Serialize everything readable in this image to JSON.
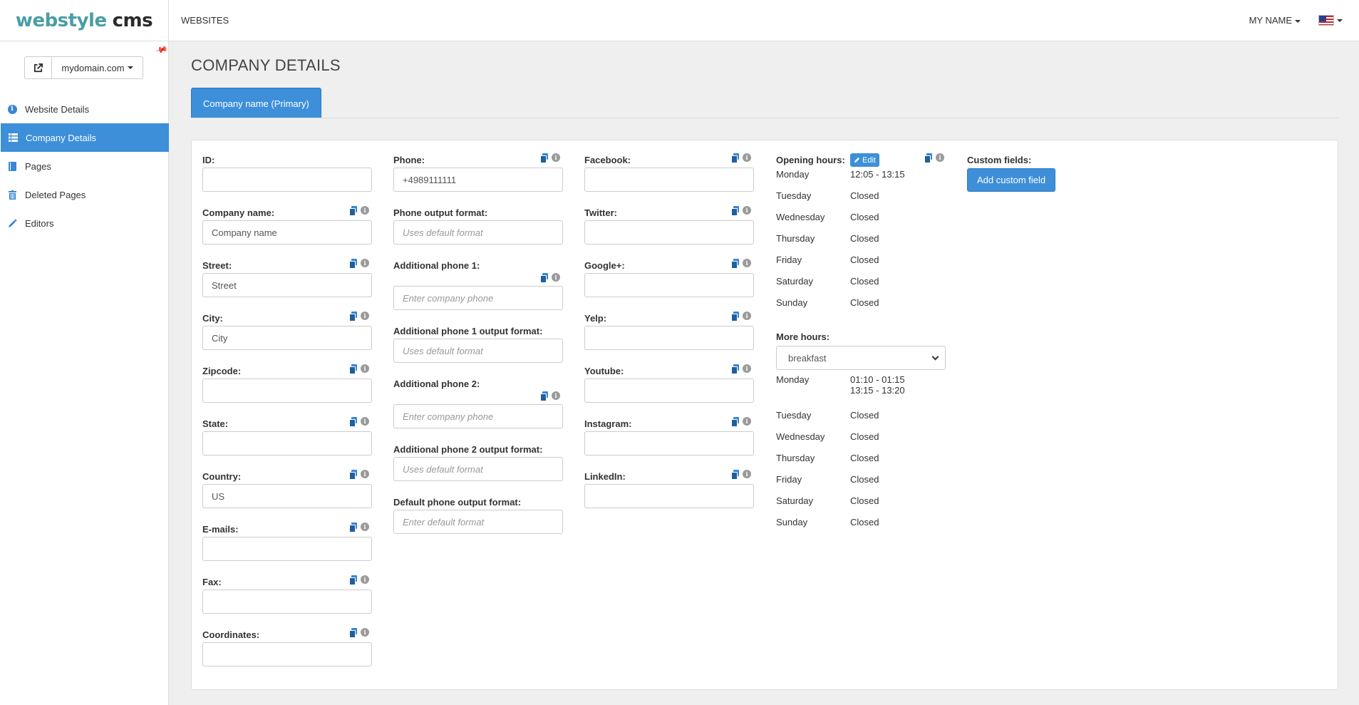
{
  "header": {
    "logo_part1": "webstyle",
    "logo_part2": "cms",
    "nav_websites": "WEBSITES",
    "user_menu": "MY NAME"
  },
  "sidebar": {
    "domain": "mydomain.com",
    "items": [
      {
        "label": "Website Details",
        "icon": "info-icon"
      },
      {
        "label": "Company Details",
        "icon": "list-icon",
        "active": true
      },
      {
        "label": "Pages",
        "icon": "book-icon"
      },
      {
        "label": "Deleted Pages",
        "icon": "trash-icon"
      },
      {
        "label": "Editors",
        "icon": "pencil-icon"
      }
    ]
  },
  "main": {
    "title": "COMPANY DETAILS",
    "tab_primary": "Company name (Primary)"
  },
  "col1": [
    {
      "label": "ID:",
      "value": "",
      "placeholder": ""
    },
    {
      "label": "Company name:",
      "value": "",
      "placeholder": "Company name"
    },
    {
      "label": "Street:",
      "value": "",
      "placeholder": "Street"
    },
    {
      "label": "City:",
      "value": "",
      "placeholder": "City"
    },
    {
      "label": "Zipcode:",
      "value": "",
      "placeholder": ""
    },
    {
      "label": "State:",
      "value": "",
      "placeholder": ""
    },
    {
      "label": "Country:",
      "value": "US",
      "placeholder": ""
    },
    {
      "label": "E-mails:",
      "value": "",
      "placeholder": ""
    },
    {
      "label": "Fax:",
      "value": "",
      "placeholder": ""
    },
    {
      "label": "Coordinates:",
      "value": "",
      "placeholder": ""
    }
  ],
  "col2": [
    {
      "label": "Phone:",
      "value": "+4989111111",
      "placeholder": ""
    },
    {
      "label": "Phone output format:",
      "value": "",
      "placeholder": "Uses default format"
    },
    {
      "label": "Additional phone 1:",
      "value": "",
      "placeholder": "Enter company phone"
    },
    {
      "label": "Additional phone 1 output format:",
      "value": "",
      "placeholder": "Uses default format"
    },
    {
      "label": "Additional phone 2:",
      "value": "",
      "placeholder": "Enter company phone"
    },
    {
      "label": "Additional phone 2 output format:",
      "value": "",
      "placeholder": "Uses default format"
    },
    {
      "label": "Default phone output format:",
      "value": "",
      "placeholder": "Enter default format"
    }
  ],
  "col3": [
    {
      "label": "Facebook:",
      "value": ""
    },
    {
      "label": "Twitter:",
      "value": ""
    },
    {
      "label": "Google+:",
      "value": ""
    },
    {
      "label": "Yelp:",
      "value": ""
    },
    {
      "label": "Youtube:",
      "value": ""
    },
    {
      "label": "Instagram:",
      "value": ""
    },
    {
      "label": "LinkedIn:",
      "value": ""
    }
  ],
  "opening_hours": {
    "label": "Opening hours:",
    "edit_label": "Edit",
    "days": [
      {
        "day": "Monday",
        "hours": "12:05 - 13:15"
      },
      {
        "day": "Tuesday",
        "hours": "Closed"
      },
      {
        "day": "Wednesday",
        "hours": "Closed"
      },
      {
        "day": "Thursday",
        "hours": "Closed"
      },
      {
        "day": "Friday",
        "hours": "Closed"
      },
      {
        "day": "Saturday",
        "hours": "Closed"
      },
      {
        "day": "Sunday",
        "hours": "Closed"
      }
    ]
  },
  "more_hours": {
    "label": "More hours:",
    "selected": "breakfast",
    "monday_day": "Monday",
    "monday_hours_1": "01:10 - 01:15",
    "monday_hours_2": "13:15 - 13:20",
    "days": [
      {
        "day": "Tuesday",
        "hours": "Closed"
      },
      {
        "day": "Wednesday",
        "hours": "Closed"
      },
      {
        "day": "Thursday",
        "hours": "Closed"
      },
      {
        "day": "Friday",
        "hours": "Closed"
      },
      {
        "day": "Saturday",
        "hours": "Closed"
      },
      {
        "day": "Sunday",
        "hours": "Closed"
      }
    ]
  },
  "custom_fields": {
    "label": "Custom fields:",
    "add_button": "Add custom field"
  }
}
